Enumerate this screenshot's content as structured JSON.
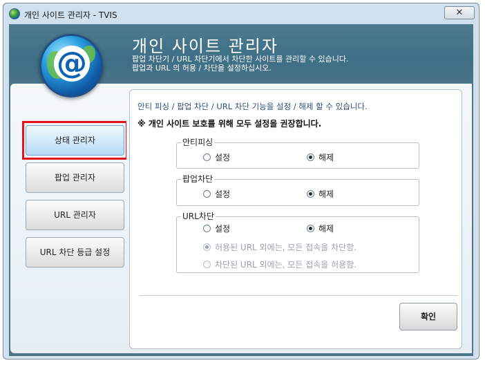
{
  "window": {
    "title": "개인 사이트 관리자 - TVIS",
    "close_glyph": "✕"
  },
  "header": {
    "title": "개인 사이트 관리자",
    "desc_line1": "팝업 차단기 / URL 차단기에서 차단한 사이트를 관리할 수 있습니다.",
    "desc_line2": "팝업과 URL 의 허용 / 차단을 설정하십시오.",
    "logo_glyph": "@"
  },
  "sidebar": {
    "items": [
      {
        "label": "상태 관리자"
      },
      {
        "label": "팝업 관리자"
      },
      {
        "label": "URL 관리자"
      },
      {
        "label": "URL 차단 등급 설정"
      }
    ]
  },
  "main": {
    "intro": "안티 피싱 / 팝업 차단 / URL 차단 기능을 설정 / 해제 할 수 있습니다.",
    "notice": "※ 개인 사이트 보호를 위해 모두 설정을 권장합니다.",
    "groups": {
      "anti_phishing": {
        "title": "안티피싱",
        "on": "설정",
        "off": "해제",
        "selected": "off"
      },
      "popup_block": {
        "title": "팝업차단",
        "on": "설정",
        "off": "해제",
        "selected": "off"
      },
      "url_block": {
        "title": "URL차단",
        "on": "설정",
        "off": "해제",
        "selected": "off",
        "sub_allow_only": "허용된 URL 외에는, 모든 접속을 차단함.",
        "sub_block_only": "차단된 URL 외에는, 모든 접속을 허용함.",
        "sub_selected": "allow_only"
      }
    },
    "ok_label": "확인"
  },
  "colors": {
    "header_bg": "#3e6f85",
    "highlight_border": "#e0141a",
    "intro_text": "#2f4f77"
  }
}
